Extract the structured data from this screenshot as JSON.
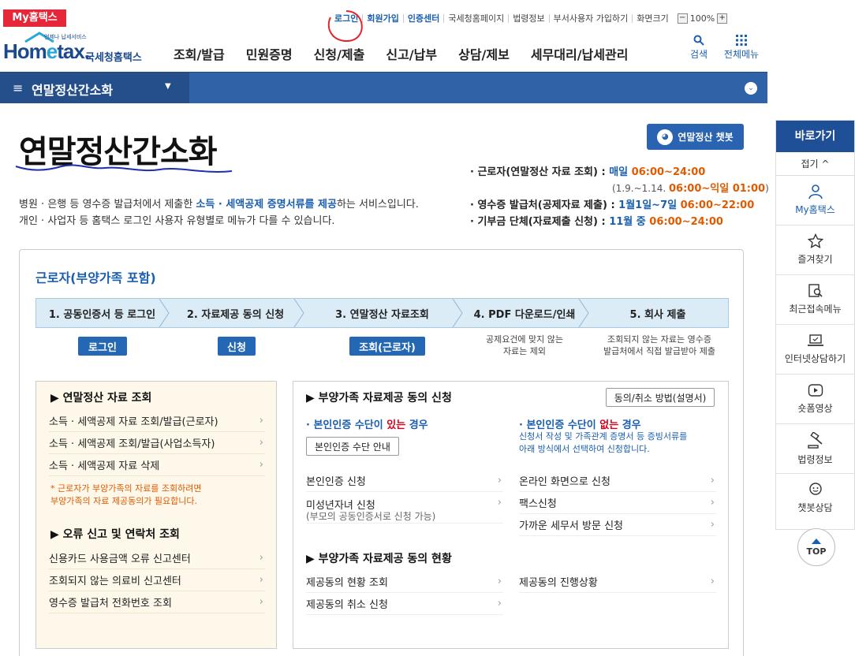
{
  "utility": {
    "myhome_label": "My홈택스",
    "links": [
      "로그인",
      "회원가입",
      "인증센터",
      "국세청홈페이지",
      "법령정보",
      "부서사용자 가입하기",
      "화면크기"
    ],
    "zoom_minus": "−",
    "zoom_value": "100%",
    "zoom_plus": "+"
  },
  "header": {
    "logo_small": "언제나 납세서비스",
    "logo_main_a": "Hom",
    "logo_main_e": "e",
    "logo_main_b": "tax.",
    "logo_sub": "국세청홈택스",
    "nav": [
      "조회/발급",
      "민원증명",
      "신청/제출",
      "신고/납부",
      "상담/제보",
      "세무대리/납세관리"
    ],
    "search_label": "검색",
    "allmenu_label": "전체메뉴"
  },
  "bluebar": {
    "menu_icon": "≡",
    "title": "연말정산간소화",
    "caret": "▼",
    "right_icon": "⌄"
  },
  "page": {
    "title": "연말정산간소화",
    "chatbot_icon": "◕",
    "chatbot_label": "연말정산 챗봇",
    "desc_line1_a": "병원 · 은행 등 영수증 발급처에서 제출한 ",
    "desc_line1_b": "소득 · 세액공제 증명서류를 제공",
    "desc_line1_c": "하는 서비스입니다.",
    "desc_line2": "개인 · 사업자 등 홈택스 로그인 사용자 유형별로 메뉴가 다를 수 있습니다."
  },
  "info": {
    "row1_label": "· 근로자(연말정산 자료 조회) : ",
    "row1_day": "매일 ",
    "row1_time": "06:00~24:00",
    "row2_a": "(1.9.~1.14. ",
    "row2_time": "06:00~익일 01:00",
    "row2_b": ")",
    "row3_label": "· 영수증 발급처(공제자료 제출) : ",
    "row3_day": "1월1일~7일 ",
    "row3_time": "06:00~22:00",
    "row4_label": "· 기부금 단체(자료제출 신청) : ",
    "row4_day": "11월 중 ",
    "row4_time": "06:00~24:00"
  },
  "main": {
    "section_label": "근로자(부양가족 포함)",
    "steps": [
      "1. 공동인증서 등 로그인",
      "2. 자료제공 동의 신청",
      "3. 연말정산 자료조회",
      "4. PDF 다운로드/인쇄",
      "5. 회사 제출"
    ],
    "step_buttons": [
      "로그인",
      "신청",
      "조회(근로자)"
    ],
    "step4_note": "공제요건에 맞지 않는\n자료는 제외",
    "step5_note": "조회되지 않는 자료는 영수증\n발급처에서 직접 발급받아 제출"
  },
  "left_panel": {
    "head1": "▶ 연말정산 자료 조회",
    "items1": [
      "소득 · 세액공제 자료 조회/발급(근로자)",
      "소득 · 세액공제 조회/발급(사업소득자)",
      "소득 · 세액공제 자료 삭제"
    ],
    "note": "* 근로자가 부양가족의 자료를 조회하려면\n  부양가족의 자료 제공동의가 필요합니다.",
    "head2": "▶ 오류 신고 및 연락처 조회",
    "items2": [
      "신용카드 사용금액 오류 신고센터",
      "조회되지 않는 의료비 신고센터",
      "영수증 발급처 전화번호 조회"
    ],
    "chevron": "›"
  },
  "right_panel": {
    "head1": "▶ 부양가족 자료제공 동의 신청",
    "guide_button": "동의/취소 방법(설명서)",
    "sub_left_a": "· 본인인증 수단이 ",
    "sub_left_b": "있는",
    "sub_left_c": " 경우",
    "sub_right_a": "· 본인인증 수단이 ",
    "sub_right_b": "없는",
    "sub_right_c": " 경우",
    "auth_guide_button": "본인인증 수단 안내",
    "right_desc": "신청서 작성 및 가족관계 증명서 등 증빙서류를\n아래 방식에서 선택하여 신청합니다.",
    "left_items": [
      "본인인증 신청",
      "미성년자녀 신청"
    ],
    "minor_note": "(부모의 공동인증서로 신청 가능)",
    "right_items": [
      "온라인 화면으로 신청",
      "팩스신청",
      "가까운 세무서 방문 신청"
    ],
    "head2": "▶ 부양가족 자료제공 동의 현황",
    "status_left": [
      "제공동의 현황 조회",
      "제공동의 취소 신청"
    ],
    "status_right": [
      "제공동의 진행상황"
    ],
    "chevron": "›"
  },
  "quick": {
    "head": "바로가기",
    "fold": "접기 ^",
    "items": [
      "My홈택스",
      "즐겨찾기",
      "최근접속메뉴",
      "인터넷상담하기",
      "숏폼영상",
      "법령정보",
      "챗봇상담"
    ],
    "top": "TOP"
  },
  "colors": {
    "brand_blue": "#2e63a8",
    "accent_red": "#e6273a",
    "orange": "#e05a00"
  }
}
